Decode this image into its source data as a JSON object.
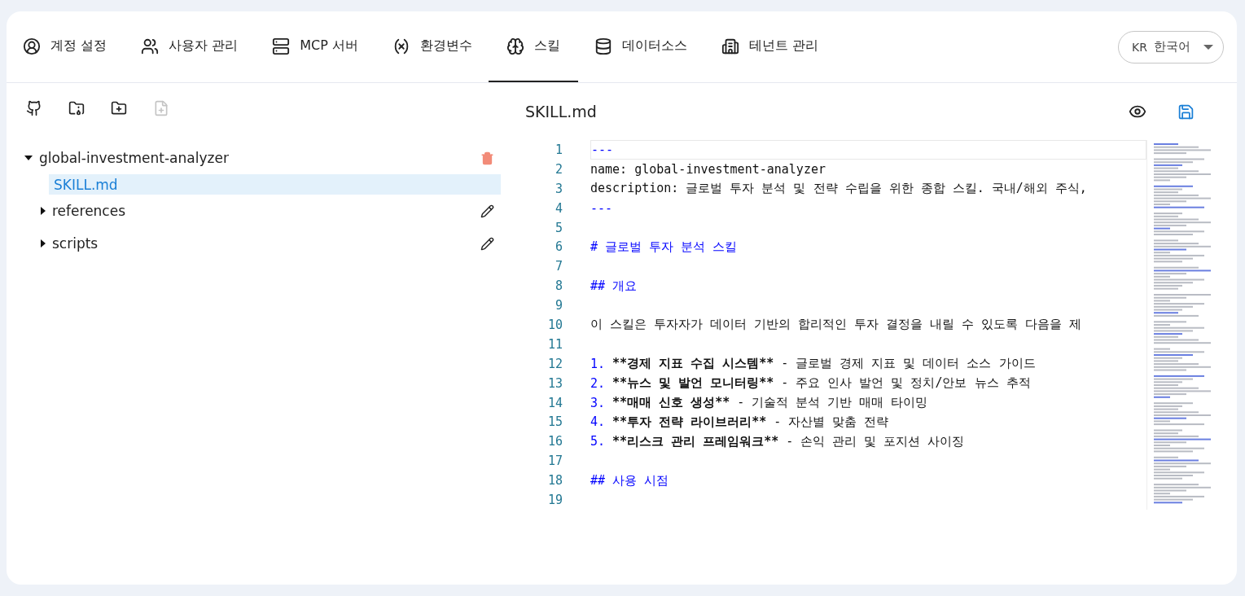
{
  "tabs": [
    {
      "label": "계정 설정",
      "selected": false
    },
    {
      "label": "사용자 관리",
      "selected": false
    },
    {
      "label": "MCP 서버",
      "selected": false
    },
    {
      "label": "환경변수",
      "selected": false
    },
    {
      "label": "스킬",
      "selected": true
    },
    {
      "label": "데이터소스",
      "selected": false
    },
    {
      "label": "테넌트 관리",
      "selected": false
    }
  ],
  "language": {
    "code": "KR",
    "label": "한국어"
  },
  "toolbar": [
    {
      "disabled": false
    },
    {
      "disabled": false
    },
    {
      "disabled": false
    },
    {
      "disabled": true
    }
  ],
  "tree": [
    {
      "name": "global-investment-analyzer",
      "kind": "folder",
      "expanded": true,
      "children": [
        {
          "name": "SKILL.md",
          "kind": "file",
          "selected": true
        },
        {
          "name": "references",
          "kind": "folder",
          "expanded": false,
          "selected": false
        },
        {
          "name": "scripts",
          "kind": "folder",
          "expanded": false,
          "selected": false
        }
      ]
    }
  ],
  "editor": {
    "filename": "SKILL.md",
    "lines": [
      {
        "number": "1",
        "active": true,
        "parts": [
          {
            "kind": "marker",
            "text": "---"
          }
        ]
      },
      {
        "number": "2",
        "active": false,
        "parts": [
          {
            "kind": "plain",
            "text": "name: global-investment-analyzer"
          }
        ]
      },
      {
        "number": "3",
        "active": false,
        "parts": [
          {
            "kind": "plain",
            "text": "description: 글로벌 투자 분석 및 전략 수립을 위한 종합 스킬. 국내/해외 주식,"
          }
        ]
      },
      {
        "number": "4",
        "active": false,
        "parts": [
          {
            "kind": "marker",
            "text": "---"
          }
        ]
      },
      {
        "number": "5",
        "active": false
      },
      {
        "number": "6",
        "active": false,
        "parts": [
          {
            "kind": "marker",
            "text": "# 글로벌 투자 분석 스킬"
          }
        ]
      },
      {
        "number": "7",
        "active": false
      },
      {
        "number": "8",
        "active": false,
        "parts": [
          {
            "kind": "marker",
            "text": "## 개요"
          }
        ]
      },
      {
        "number": "9",
        "active": false
      },
      {
        "number": "10",
        "active": false,
        "parts": [
          {
            "kind": "plain",
            "text": "이 스킬은 투자자가 데이터 기반의 합리적인 투자 결정을 내릴 수 있도록 다음을 제"
          }
        ]
      },
      {
        "number": "11",
        "active": false
      },
      {
        "number": "12",
        "active": false,
        "parts": [
          {
            "kind": "marker",
            "text": "1."
          },
          {
            "kind": "bold",
            "text": "**경제 지표 수집 시스템**"
          },
          {
            "kind": "plain",
            "text": "- 글로벌 경제 지표 및 데이터 소스 가이드"
          }
        ]
      },
      {
        "number": "13",
        "active": false,
        "parts": [
          {
            "kind": "marker",
            "text": "2."
          },
          {
            "kind": "bold",
            "text": "**뉴스 및 발언 모니터링**"
          },
          {
            "kind": "plain",
            "text": "- 주요 인사 발언 및 정치/안보 뉴스 추적"
          }
        ]
      },
      {
        "number": "14",
        "active": false,
        "parts": [
          {
            "kind": "marker",
            "text": "3."
          },
          {
            "kind": "bold",
            "text": "**매매 신호 생성**"
          },
          {
            "kind": "plain",
            "text": "- 기술적 분석 기반 매매 타이밍"
          }
        ]
      },
      {
        "number": "15",
        "active": false,
        "parts": [
          {
            "kind": "marker",
            "text": "4."
          },
          {
            "kind": "bold",
            "text": "**투자 전략 라이브러리**"
          },
          {
            "kind": "plain",
            "text": "- 자산별 맞춤 전략"
          }
        ]
      },
      {
        "number": "16",
        "active": false,
        "parts": [
          {
            "kind": "marker",
            "text": "5."
          },
          {
            "kind": "bold",
            "text": "**리스크 관리 프레임워크**"
          },
          {
            "kind": "plain",
            "text": "- 손익 관리 및 포지션 사이징"
          }
        ]
      },
      {
        "number": "17",
        "active": false
      },
      {
        "number": "18",
        "active": false,
        "parts": [
          {
            "kind": "marker",
            "text": "## 사용 시점"
          }
        ]
      },
      {
        "number": "19",
        "active": false
      }
    ]
  }
}
